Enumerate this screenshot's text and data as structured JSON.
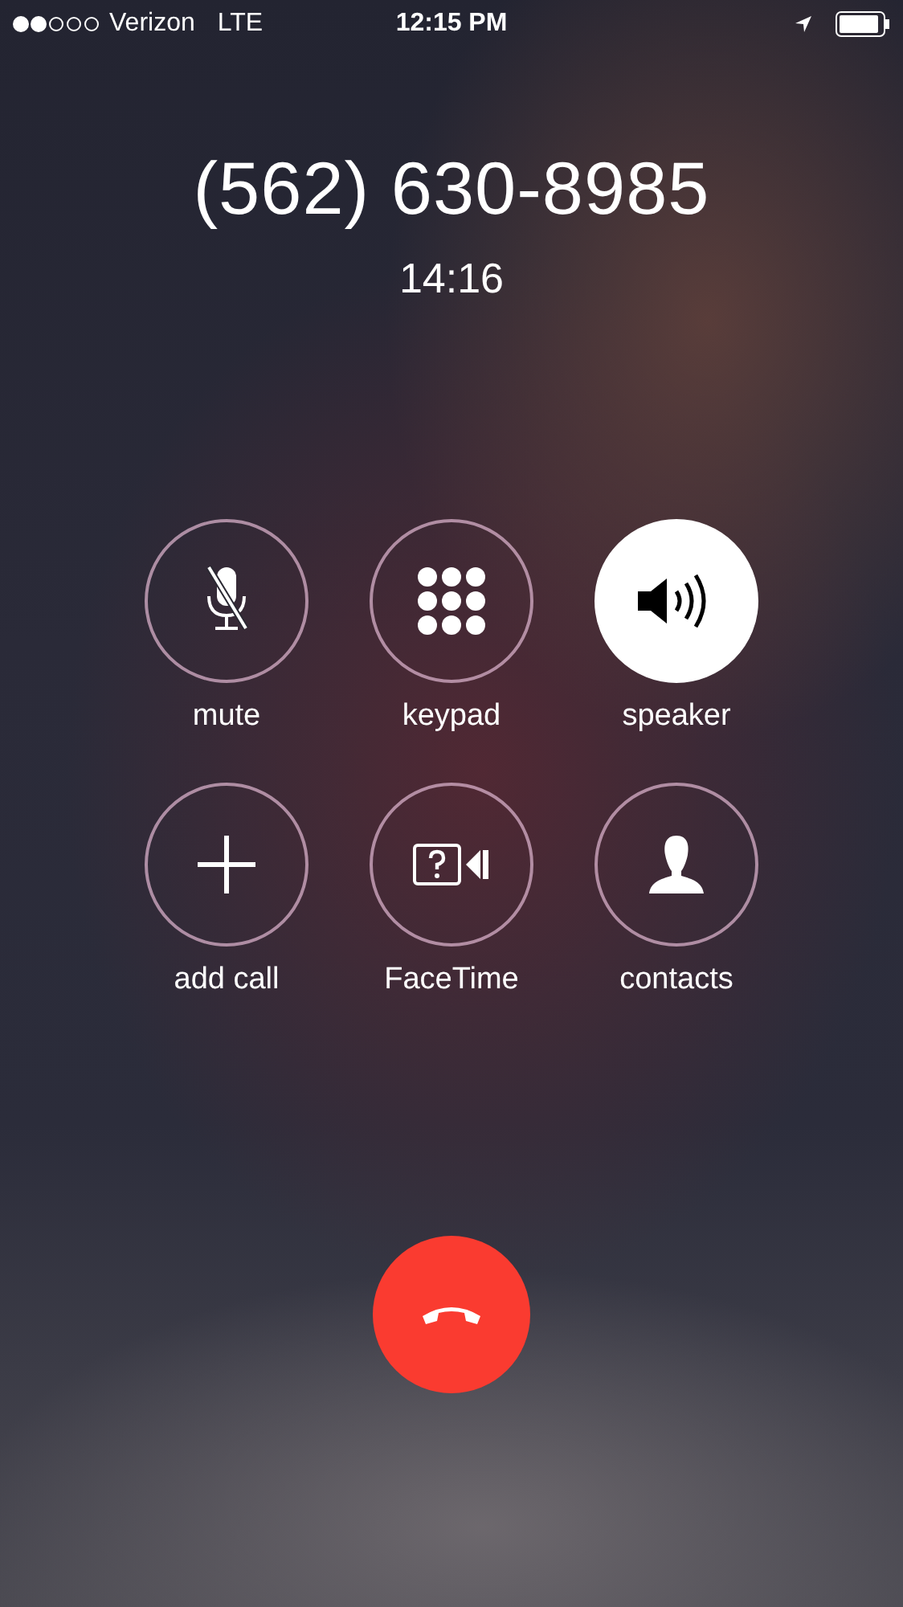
{
  "status_bar": {
    "carrier": "Verizon",
    "network": "LTE",
    "time": "12:15 PM"
  },
  "call": {
    "number": "(562) 630-8985",
    "duration": "14:16"
  },
  "buttons": [
    {
      "label": "mute",
      "selected": false
    },
    {
      "label": "keypad",
      "selected": false
    },
    {
      "label": "speaker",
      "selected": true
    },
    {
      "label": "add call",
      "selected": false
    },
    {
      "label": "FaceTime",
      "selected": false
    },
    {
      "label": "contacts",
      "selected": false
    }
  ]
}
